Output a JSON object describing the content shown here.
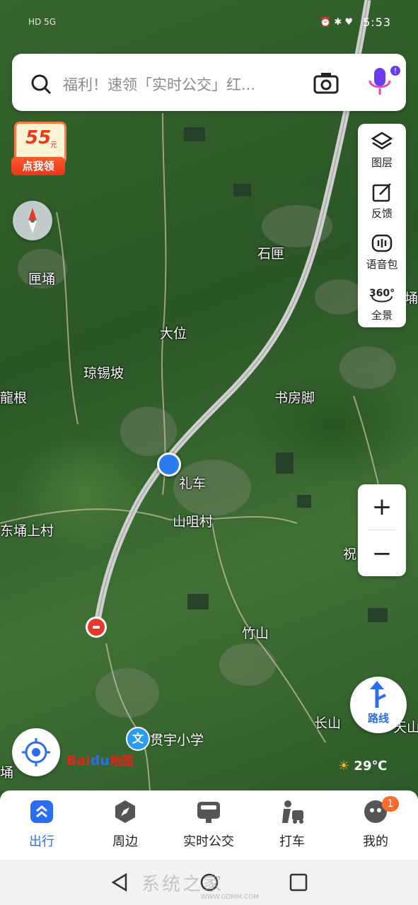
{
  "status": {
    "left_text": "HD 5G",
    "icons": "⏰ ✱ ♥",
    "time": "5:53"
  },
  "search": {
    "placeholder": "福利！速领「实时公交」红..."
  },
  "promo": {
    "amount": "55",
    "unit": "元",
    "button": "点我领"
  },
  "side_tools": [
    {
      "label": "图层",
      "icon": "layers-icon"
    },
    {
      "label": "反馈",
      "icon": "feedback-icon"
    },
    {
      "label": "语音包",
      "icon": "voice-pack-icon"
    },
    {
      "label": "全景",
      "icon": "panorama-360-icon",
      "icon_text": "360°"
    }
  ],
  "zoom": {
    "in": "+",
    "out": "−"
  },
  "route": {
    "label": "路线"
  },
  "logo": {
    "bai": "Bai",
    "du": "du",
    "map": "地图"
  },
  "weather": {
    "temp": "29℃",
    "icon": "partly-sunny-icon"
  },
  "map_labels": {
    "shi_li": "石匣",
    "kuang_yong": "匣埇",
    "da_wei": "大位",
    "qiong_xi_po": "琼锡坡",
    "long_gen": "龍根",
    "shu_fang_jiao": "书房脚",
    "li_che": "礼车",
    "shan_ju_cun": "山咀村",
    "dong_yong_shang_cun": "东埇上村",
    "zhu": "祝",
    "zhu_shan": "竹山",
    "chang_shan": "长山",
    "tian_shan": "天山",
    "yong": "埇",
    "yong_left": "埇"
  },
  "poi_school": {
    "badge": "文",
    "name": "贯宇小学"
  },
  "tabs": [
    {
      "label": "出行",
      "active": true
    },
    {
      "label": "周边",
      "active": false
    },
    {
      "label": "实时公交",
      "active": false
    },
    {
      "label": "打车",
      "active": false
    },
    {
      "label": "我的",
      "active": false,
      "badge": "1"
    }
  ],
  "watermark": {
    "text": "系统之家",
    "sub": "WWW.GDMM.COM"
  },
  "colors": {
    "accent": "#2b6cf0",
    "promo": "#e8361a",
    "map_green": "#2f5a2a"
  }
}
